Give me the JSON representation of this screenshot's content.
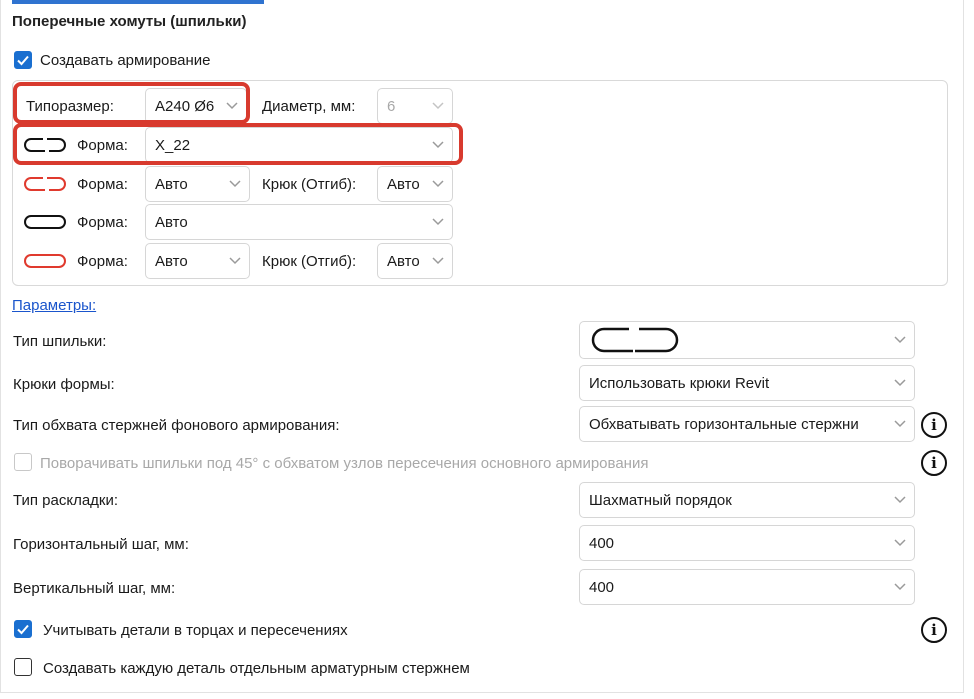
{
  "section": {
    "title": "Поперечные хомуты (шпильки)"
  },
  "create_reinforcement": {
    "label": "Создавать армирование",
    "checked": true
  },
  "group": {
    "size_label": "Типоразмер:",
    "size_value": "А240 Ø6",
    "diameter_label": "Диаметр, мм:",
    "diameter_value": "6",
    "shape_label": "Форма:",
    "hook_label": "Крюк (Отгиб):",
    "rows": [
      {
        "shape_value": "X_22"
      },
      {
        "shape_value": "Авто",
        "hook_value": "Авто"
      },
      {
        "shape_value": "Авто"
      },
      {
        "shape_value": "Авто",
        "hook_value": "Авто"
      }
    ]
  },
  "params": {
    "link": "Параметры:",
    "pin_type_label": "Тип шпильки:",
    "hooks_label": "Крюки формы:",
    "hooks_value": "Использовать крюки Revit",
    "wrap_label": "Тип обхвата стержней фонового армирования:",
    "wrap_value": "Обхватывать горизонтальные стержни",
    "rotate_label": "Поворачивать шпильки под 45° с обхватом узлов пересечения основного армирования",
    "layout_label": "Тип раскладки:",
    "layout_value": "Шахматный порядок",
    "hstep_label": "Горизонтальный шаг, мм:",
    "hstep_value": "400",
    "vstep_label": "Вертикальный шаг, мм:",
    "vstep_value": "400",
    "consider_label": "Учитывать детали в торцах и пересечениях",
    "consider_checked": true,
    "separate_label": "Создавать каждую деталь отдельным арматурным стержнем",
    "separate_checked": false
  },
  "colors": {
    "accent": "#2f73d0",
    "checkbox": "#1a6fd0",
    "highlight": "#d83a2e",
    "shape_red": "#e03a2e"
  },
  "icons": {
    "info": "i"
  }
}
